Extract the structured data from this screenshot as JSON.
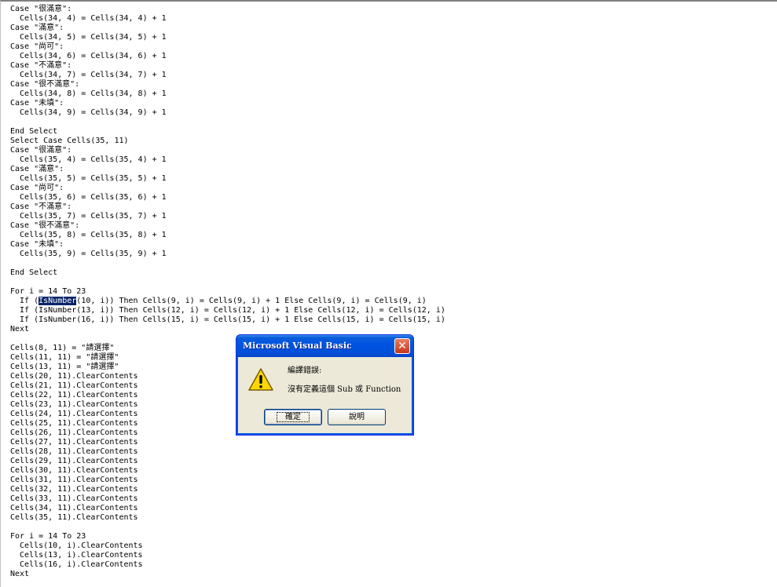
{
  "code_lines": [
    "Case \"很滿意\":",
    "  Cells(34, 4) = Cells(34, 4) + 1",
    "Case \"滿意\":",
    "  Cells(34, 5) = Cells(34, 5) + 1",
    "Case \"尚可\":",
    "  Cells(34, 6) = Cells(34, 6) + 1",
    "Case \"不滿意\":",
    "  Cells(34, 7) = Cells(34, 7) + 1",
    "Case \"很不滿意\":",
    "  Cells(34, 8) = Cells(34, 8) + 1",
    "Case \"未填\":",
    "  Cells(34, 9) = Cells(34, 9) + 1",
    "",
    "End Select",
    "Select Case Cells(35, 11)",
    "Case \"很滿意\":",
    "  Cells(35, 4) = Cells(35, 4) + 1",
    "Case \"滿意\":",
    "  Cells(35, 5) = Cells(35, 5) + 1",
    "Case \"尚可\":",
    "  Cells(35, 6) = Cells(35, 6) + 1",
    "Case \"不滿意\":",
    "  Cells(35, 7) = Cells(35, 7) + 1",
    "Case \"很不滿意\":",
    "  Cells(35, 8) = Cells(35, 8) + 1",
    "Case \"未填\":",
    "  Cells(35, 9) = Cells(35, 9) + 1",
    "",
    "End Select",
    "",
    "For i = 14 To 23",
    "  If (IsNumber(10, i)) Then Cells(9, i) = Cells(9, i) + 1 Else Cells(9, i) = Cells(9, i)",
    "  If (IsNumber(13, i)) Then Cells(12, i) = Cells(12, i) + 1 Else Cells(12, i) = Cells(12, i)",
    "  If (IsNumber(16, i)) Then Cells(15, i) = Cells(15, i) + 1 Else Cells(15, i) = Cells(15, i)",
    "Next",
    "",
    "Cells(8, 11) = \"請選擇\"",
    "Cells(11, 11) = \"請選擇\"",
    "Cells(13, 11) = \"請選擇\"",
    "Cells(20, 11).ClearContents",
    "Cells(21, 11).ClearContents",
    "Cells(22, 11).ClearContents",
    "Cells(23, 11).ClearContents",
    "Cells(24, 11).ClearContents",
    "Cells(25, 11).ClearContents",
    "Cells(26, 11).ClearContents",
    "Cells(27, 11).ClearContents",
    "Cells(28, 11).ClearContents",
    "Cells(29, 11).ClearContents",
    "Cells(30, 11).ClearContents",
    "Cells(31, 11).ClearContents",
    "Cells(32, 11).ClearContents",
    "Cells(33, 11).ClearContents",
    "Cells(34, 11).ClearContents",
    "Cells(35, 11).ClearContents",
    "",
    "For i = 14 To 23",
    "  Cells(10, i).ClearContents",
    "  Cells(13, i).ClearContents",
    "  Cells(16, i).ClearContents",
    "Next"
  ],
  "selection": {
    "line": 31,
    "text": "IsNumber"
  },
  "dialog": {
    "title": "Microsoft Visual Basic",
    "close_glyph": "✕",
    "icon": "warning-icon",
    "message_line1": "編譯錯誤:",
    "message_line2": "沒有定義這個 Sub 或 Function",
    "ok_label": "確定",
    "help_label": "說明"
  },
  "colors": {
    "keyword": "#00007f",
    "selection_bg": "#0a246a",
    "titlebar": "#0054e3",
    "dialog_bg": "#ece9d8",
    "close_button": "#c4371a",
    "warning_yellow": "#ffd700"
  }
}
